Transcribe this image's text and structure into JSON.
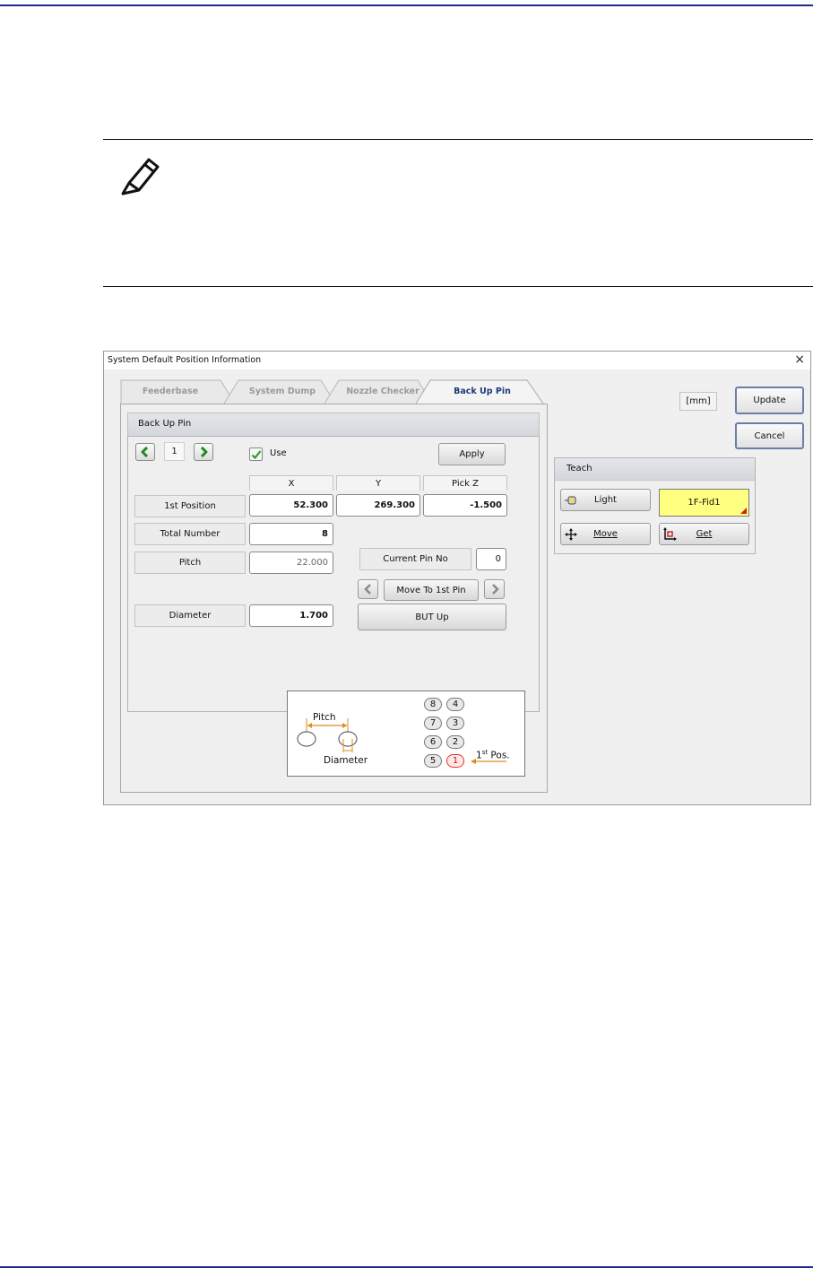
{
  "dialog": {
    "title": "System Default Position Information",
    "close_glyph": "×",
    "tabs": [
      {
        "label": "Feederbase",
        "active": false
      },
      {
        "label": "System Dump",
        "active": false
      },
      {
        "label": "Nozzle Checker",
        "active": false
      },
      {
        "label": "Back Up Pin",
        "active": true
      }
    ],
    "unit_label": "[mm]",
    "update_label": "Update",
    "cancel_label": "Cancel"
  },
  "backup_pin": {
    "group_title": "Back Up Pin",
    "index_value": "1",
    "use_label": "Use",
    "use_checked": true,
    "apply_label": "Apply",
    "columns": [
      "X",
      "Y",
      "Pick Z"
    ],
    "first_position": {
      "label": "1st Position",
      "x": "52.300",
      "y": "269.300",
      "pick_z": "-1.500"
    },
    "total_number": {
      "label": "Total Number",
      "value": "8"
    },
    "pitch": {
      "label": "Pitch",
      "value": "22.000"
    },
    "current_pin": {
      "label": "Current Pin No",
      "value": "0"
    },
    "move_to_first_label": "Move To 1st Pin",
    "diameter": {
      "label": "Diameter",
      "value": "1.700"
    },
    "but_up_label": "BUT Up"
  },
  "diagram": {
    "pitch_label": "Pitch",
    "diameter_label": "Diameter",
    "pins": [
      "8",
      "4",
      "7",
      "3",
      "6",
      "2",
      "5",
      "1"
    ],
    "first_pos_sup": "st",
    "first_pos_prefix": "1",
    "first_pos_suffix": " Pos.",
    "highlight_color": "#e03030"
  },
  "teach": {
    "title": "Teach",
    "light_label": "Light",
    "fid_label": "1F-Fid1",
    "fid_color": "#ffff80",
    "move_label": "Move",
    "get_label": "Get"
  },
  "colors": {
    "rule_blue": "#1f2a8a",
    "active_tab_text": "#1d3a78",
    "check_green": "#2e9b2e"
  }
}
